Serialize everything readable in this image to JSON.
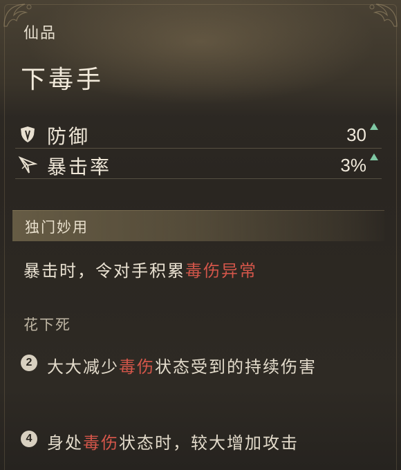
{
  "item": {
    "rarity": "仙品",
    "name": "下毒手"
  },
  "stats": [
    {
      "icon": "shield-icon",
      "label": "防御",
      "value": "30",
      "change": "up"
    },
    {
      "icon": "crit-blade-icon",
      "label": "暴击率",
      "value": "3%",
      "change": "up"
    }
  ],
  "unique_effect": {
    "header": "独门妙用",
    "text_before": "暴击时，令对手积累",
    "text_highlight": "毒伤异常"
  },
  "set_bonus": {
    "name": "花下死",
    "items": [
      {
        "count": "2",
        "before": "大大减少",
        "highlight": "毒伤",
        "after": "状态受到的持续伤害"
      },
      {
        "count": "4",
        "before": "身处",
        "highlight": "毒伤",
        "after": "状态时，较大增加攻击"
      }
    ]
  },
  "colors": {
    "highlight": "#d4564a",
    "stat_up_arrow": "#7fc8a4",
    "text": "#ebe3d3"
  }
}
